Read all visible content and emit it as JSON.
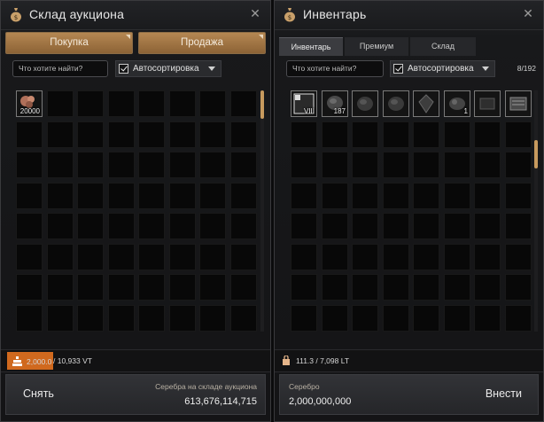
{
  "auction": {
    "title": "Склад аукциона",
    "tabs": [
      "Покупка",
      "Продажа"
    ],
    "search_placeholder": "Что хотите найти?",
    "autosort_label": "Автосортировка",
    "items": [
      {
        "icon": "ore-icon",
        "qty": "20000"
      }
    ],
    "weight_current": "2,000.0",
    "weight_total": " / 10,933 VT",
    "withdraw_label": "Снять",
    "silver_caption": "Серебра на складе аукциона",
    "silver_amount": "613,676,114,715"
  },
  "inventory": {
    "title": "Инвентарь",
    "tabs": [
      "Инвентарь",
      "Премиум",
      "Склад"
    ],
    "active_tab": 0,
    "search_placeholder": "Что хотите найти?",
    "autosort_label": "Автосортировка",
    "slot_count": "8/192",
    "items": [
      {
        "icon": "enhance-scroll-icon",
        "qty": "VIII"
      },
      {
        "icon": "black-stone-icon",
        "qty": "187"
      },
      {
        "icon": "stone-icon",
        "qty": ""
      },
      {
        "icon": "stone-icon",
        "qty": ""
      },
      {
        "icon": "crystal-icon",
        "qty": ""
      },
      {
        "icon": "ore-chunk-icon",
        "qty": "1"
      },
      {
        "icon": "dark-item-icon",
        "qty": ""
      },
      {
        "icon": "book-icon",
        "qty": ""
      }
    ],
    "weight": "111.3 / 7,098 LT",
    "silver_caption": "Серебро",
    "silver_amount": "2,000,000,000",
    "deposit_label": "Внести"
  },
  "colors": {
    "accent": "#c79a5e",
    "weight_highlight": "#d0691e"
  }
}
